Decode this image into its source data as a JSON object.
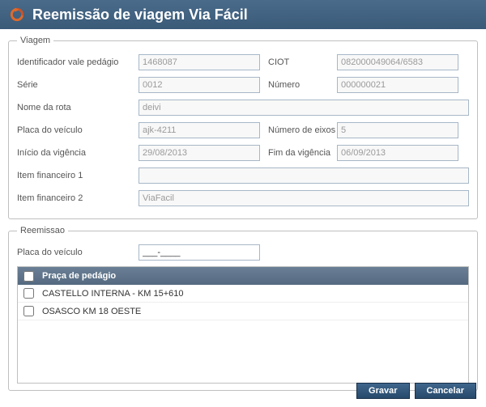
{
  "title": "Reemissão de viagem Via Fácil",
  "viagem": {
    "legend": "Viagem",
    "labels": {
      "id_vale": "Identificador vale pedágio",
      "ciot": "CIOT",
      "serie": "Série",
      "numero": "Número",
      "nome_rota": "Nome da rota",
      "placa": "Placa do veículo",
      "num_eixos": "Número de eixos",
      "inicio": "Início da vigência",
      "fim": "Fim da vigência",
      "item1": "Item financeiro 1",
      "item2": "Item financeiro 2"
    },
    "values": {
      "id_vale": "1468087",
      "ciot": "082000049064/6583",
      "serie": "0012",
      "numero": "000000021",
      "nome_rota": "deivi",
      "placa": "ajk-4211",
      "num_eixos": "5",
      "inicio": "29/08/2013",
      "fim": "06/09/2013",
      "item1": "",
      "item2": "ViaFacil"
    }
  },
  "reemissao": {
    "legend": "Reemissao",
    "placa_label": "Placa do veículo",
    "placa_value": "___-____",
    "grid_header": "Praça de pedágio",
    "rows": [
      "CASTELLO INTERNA - KM 15+610",
      "OSASCO KM 18 OESTE"
    ]
  },
  "buttons": {
    "gravar": "Gravar",
    "cancelar": "Cancelar"
  }
}
